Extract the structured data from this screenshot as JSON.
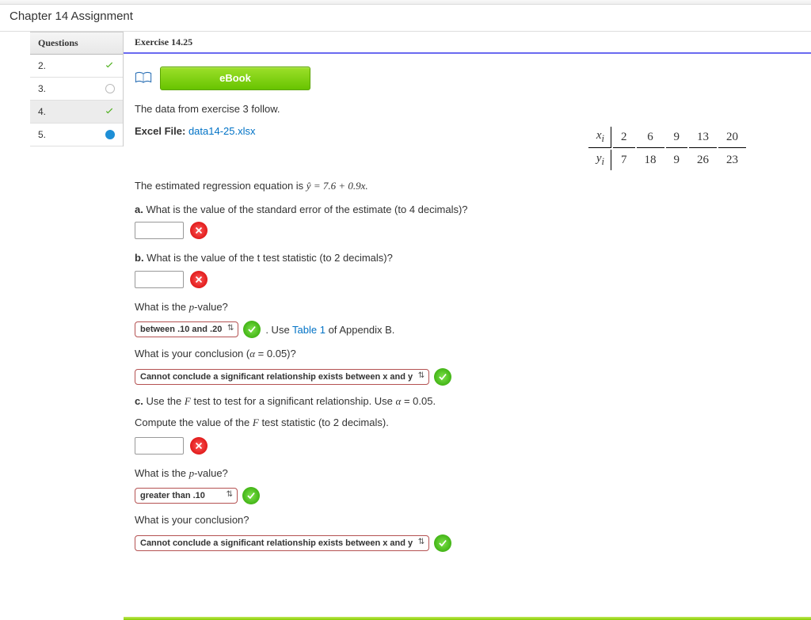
{
  "header": {
    "title": "Chapter 14 Assignment"
  },
  "sidebar": {
    "heading": "Questions",
    "items": [
      {
        "num": "2.",
        "status": "check"
      },
      {
        "num": "3.",
        "status": "open"
      },
      {
        "num": "4.",
        "status": "check",
        "active": true
      },
      {
        "num": "5.",
        "status": "current"
      }
    ]
  },
  "main": {
    "tab": "Exercise 14.25",
    "ebook_label": "eBook",
    "intro": "The data from exercise 3 follow.",
    "excel_label": "Excel File:",
    "excel_file": "data14-25.xlsx",
    "data_table": {
      "x_label": "x",
      "y_label": "y",
      "sub": "i",
      "x": [
        "2",
        "6",
        "9",
        "13",
        "20"
      ],
      "y": [
        "7",
        "18",
        "9",
        "26",
        "23"
      ]
    },
    "equation_pre": "The estimated regression equation is ",
    "equation_math": "ŷ = 7.6 + 0.9x.",
    "qa": {
      "label": "a.",
      "text": " What is the value of the standard error of the estimate (to 4 decimals)?"
    },
    "qb": {
      "label": "b.",
      "text": " What is the value of the t test statistic (to 2 decimals)?"
    },
    "pvalue_q": "What is the p-value?",
    "pvalue_sel": "between .10 and .20",
    "pvalue_hint_pre": ". Use ",
    "pvalue_hint_link": "Table 1",
    "pvalue_hint_post": " of Appendix B.",
    "conclusion_q": "What is your conclusion (α = 0.05)?",
    "conclusion_sel": "Cannot conclude a significant relationship exists between x and y",
    "qc": {
      "label": "c.",
      "text": " Use the F test to test for a significant relationship. Use α = 0.05."
    },
    "qc_sub": "Compute the value of the F test statistic (to 2 decimals).",
    "pvalue_q2": "What is the p-value?",
    "pvalue_sel2": "greater than .10",
    "conclusion_q2": "What is your conclusion?",
    "conclusion_sel2": "Cannot conclude a significant relationship exists between x and y"
  }
}
